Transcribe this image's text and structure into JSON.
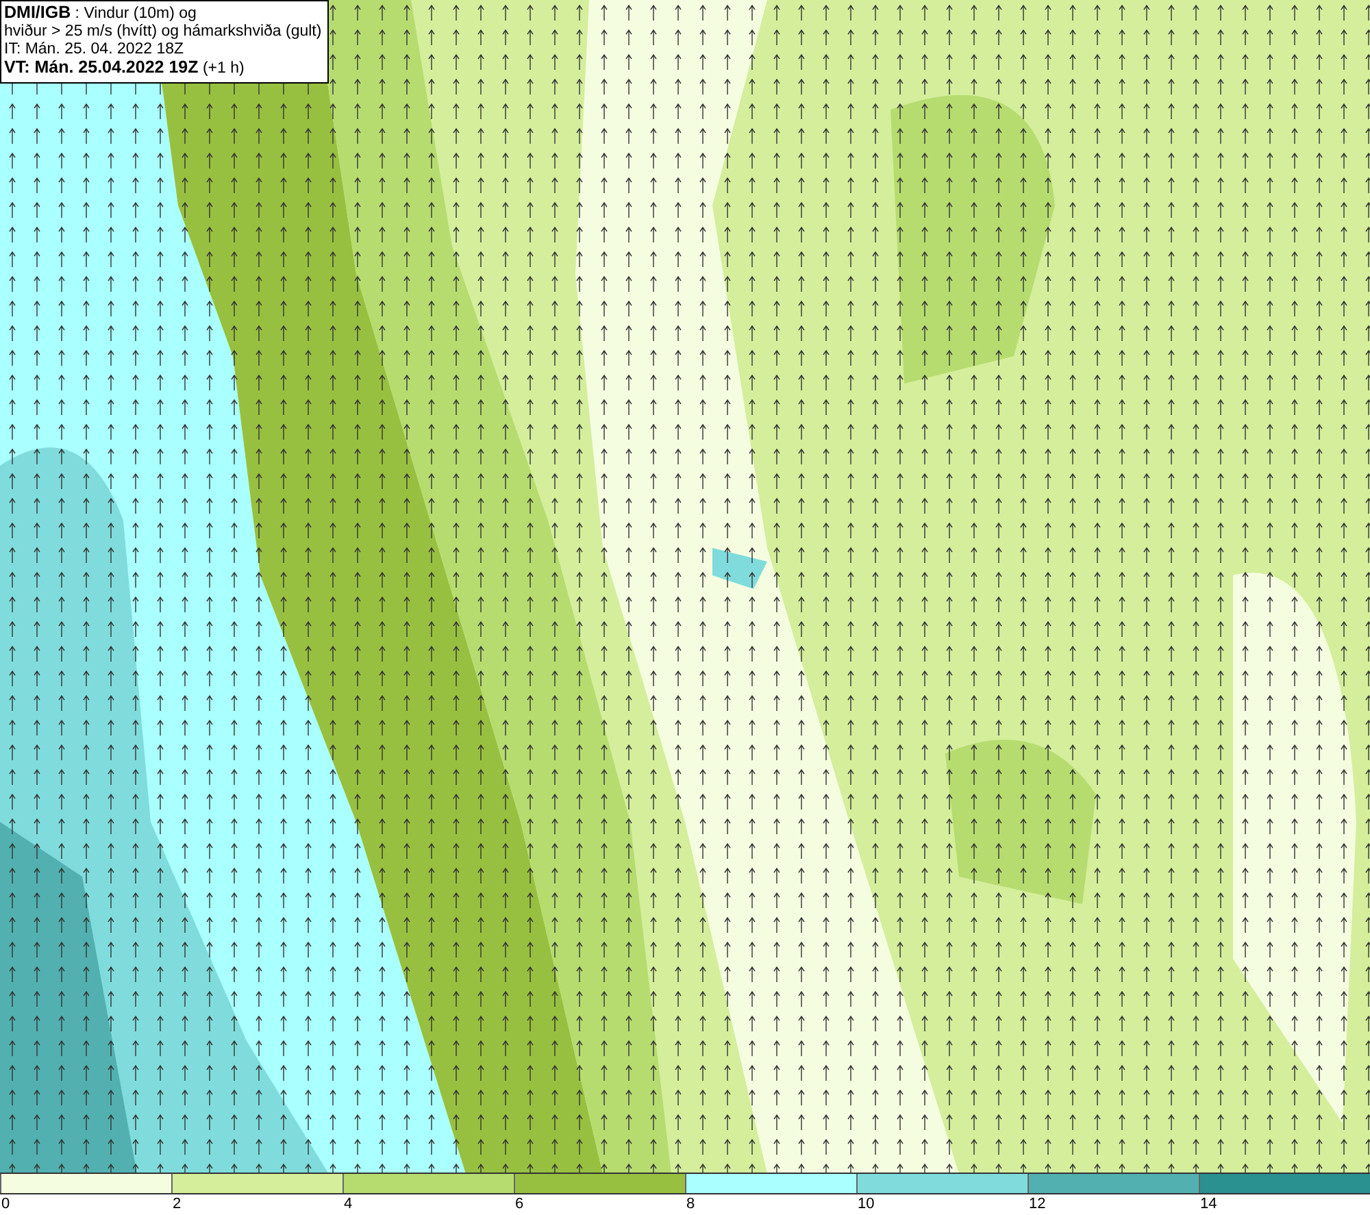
{
  "header": {
    "lines": [
      "**DMI/IGB** : Vindur (10m) og",
      "hviður > 25 m/s (hvítt) og hámarkshviða (gult)",
      "IT: Mán. 25. 04. 2022 18Z",
      "**VT: Mán. 25.04.2022 19Z** (+1 h)"
    ]
  },
  "legend": {
    "bins": [
      {
        "color": "#f5fde0"
      },
      {
        "color": "#d4ee9c"
      },
      {
        "color": "#b6dc70"
      },
      {
        "color": "#98c040"
      },
      {
        "color": "#aaffff"
      },
      {
        "color": "#80dcdc"
      },
      {
        "color": "#52b0b0"
      },
      {
        "color": "#2a9090"
      }
    ],
    "ticks": [
      "0",
      "2",
      "4",
      "6",
      "8",
      "10",
      "12",
      "14"
    ]
  }
}
